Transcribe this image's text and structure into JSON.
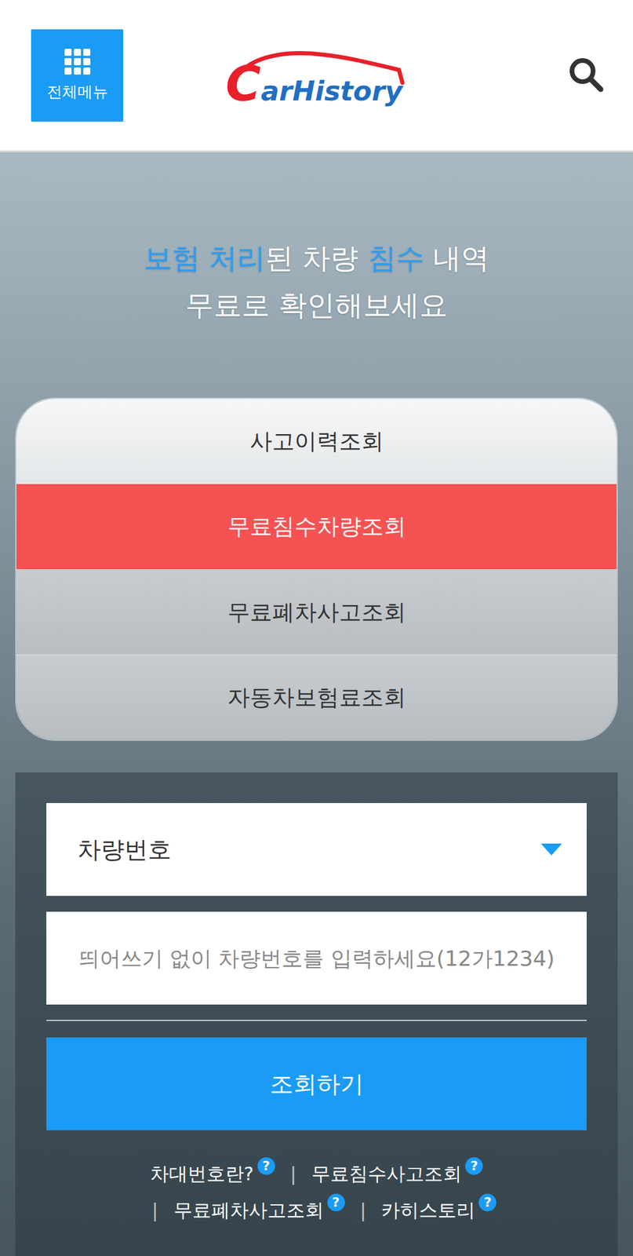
{
  "header": {
    "menu_label": "전체메뉴",
    "logo": {
      "initial": "C",
      "rest": "arHistory"
    }
  },
  "hero": {
    "line1": [
      {
        "text": "보험 처리",
        "highlight": true
      },
      {
        "text": "된 차량 ",
        "highlight": false
      },
      {
        "text": "침수",
        "highlight": true
      },
      {
        "text": " 내역",
        "highlight": false
      }
    ],
    "line2": "무료로 확인해보세요"
  },
  "tabs": [
    {
      "label": "사고이력조회",
      "selected": false
    },
    {
      "label": "무료침수차량조회",
      "selected": true
    },
    {
      "label": "무료폐차사고조회",
      "selected": false
    },
    {
      "label": "자동차보험료조회",
      "selected": false
    }
  ],
  "form": {
    "select": {
      "value": "차량번호"
    },
    "input": {
      "placeholder": "띄어쓰기 없이 차량번호를 입력하세요(12가1234)"
    },
    "button": "조회하기"
  },
  "help_links": {
    "separator": "|",
    "items": [
      {
        "label": "차대번호란?",
        "badge": "?"
      },
      {
        "label": "무료침수사고조회",
        "badge": "?"
      },
      {
        "label": "무료폐차사고조회",
        "badge": "?"
      },
      {
        "label": "카히스토리",
        "badge": "?"
      }
    ]
  }
}
